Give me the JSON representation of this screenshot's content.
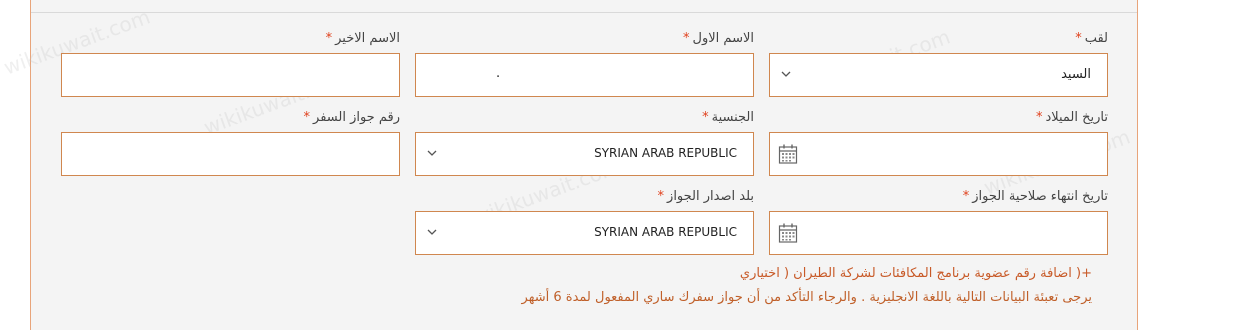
{
  "required_mark": "*",
  "fields": {
    "title_label": "لقب",
    "title_value": "السيد",
    "first_name_label": "الاسم الاول",
    "first_name_value": "",
    "last_name_label": "الاسم الاخير",
    "last_name_value": "",
    "dob_label": "تاريخ الميلاد",
    "nationality_label": "الجنسية",
    "nationality_value": "SYRIAN ARAB REPUBLIC",
    "passport_number_label": "رقم جواز السفر",
    "passport_expiry_label": "تاريخ انتهاء صلاحية الجواز",
    "issuing_country_label": "بلد اصدار الجواز",
    "issuing_country_value": "SYRIAN ARAB REPUBLIC"
  },
  "notes": {
    "add_membership": "+( اضافة رقم عضوية برنامج المكافئات لشركة الطيران ( اختياري",
    "instructions": "يرجى تعبئة البيانات التالية باللغة الانجليزية . والرجاء التأكد من أن جواز سفرك ساري المفعول لمدة 6 أشهر"
  },
  "watermark": "wikikuwait.com",
  "colors": {
    "accent": "#d0874f",
    "required": "#e0401c",
    "note": "#c0602a"
  }
}
